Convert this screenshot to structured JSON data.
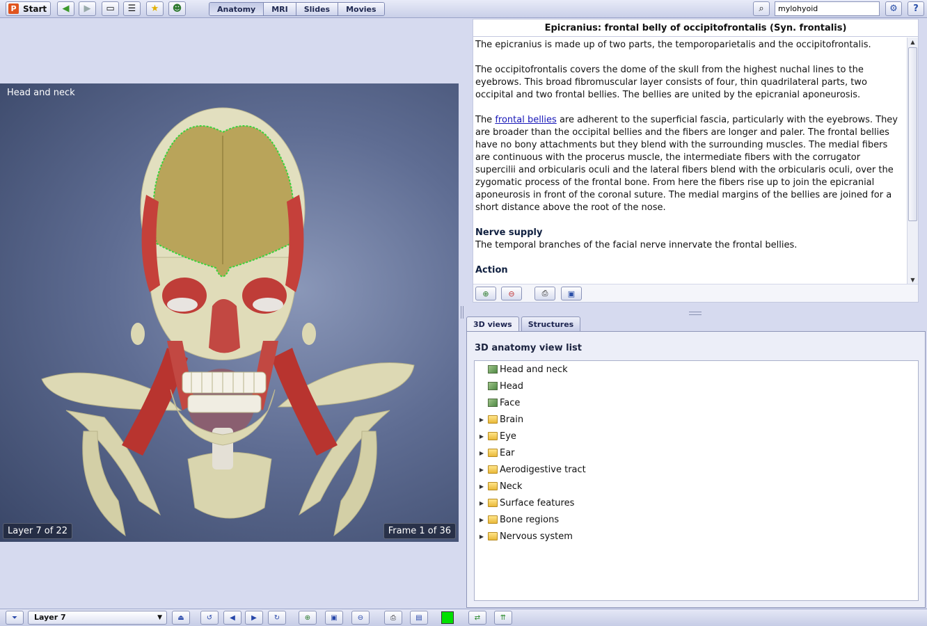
{
  "toolbar": {
    "start_label": "Start",
    "tabs": [
      "Anatomy",
      "MRI",
      "Slides",
      "Movies"
    ],
    "active_tab": "Anatomy",
    "search_value": "mylohyoid"
  },
  "viewer": {
    "title": "Head and neck",
    "layer_status": "Layer 7 of 22",
    "frame_status": "Frame 1 of 36"
  },
  "info": {
    "title": "Epicranius: frontal belly of occipitofrontalis (Syn. frontalis)",
    "para1": "The epicranius is made up of two parts, the temporoparietalis and the occipitofrontalis.",
    "para2": "The occipitofrontalis covers the dome of the skull from the highest nuchal lines to the eyebrows. This broad fibromuscular layer consists of four, thin quadrilateral parts, two occipital and two frontal bellies. The bellies are united by the epicranial aponeurosis.",
    "para3_pre": "The ",
    "para3_link": "frontal bellies",
    "para3_post": " are adherent to the superficial fascia, particularly with the eyebrows. They are broader than the occipital bellies and the fibers are longer and paler. The frontal bellies have no bony attachments but they blend with the surrounding muscles. The medial fibers are continuous with the procerus muscle, the intermediate fibers with the corrugator supercilii and orbicularis oculi and the lateral fibers blend with the orbicularis oculi, over the zygomatic process of the frontal bone. From here the fibers rise up to join the epicranial aponeurosis in front of the coronal suture. The medial margins of the bellies are joined for a short distance above the root of the nose.",
    "nerve_heading": "Nerve supply",
    "nerve_text": "The temporal branches of the facial nerve innervate the frontal bellies.",
    "action_heading": "Action"
  },
  "panel": {
    "tabs": [
      "3D views",
      "Structures"
    ],
    "active_tab": "3D views",
    "heading": "3D anatomy view list",
    "items": [
      {
        "label": "Head and neck",
        "type": "view"
      },
      {
        "label": "Head",
        "type": "view"
      },
      {
        "label": "Face",
        "type": "view"
      },
      {
        "label": "Brain",
        "type": "folder"
      },
      {
        "label": "Eye",
        "type": "folder"
      },
      {
        "label": "Ear",
        "type": "folder"
      },
      {
        "label": "Aerodigestive tract",
        "type": "folder"
      },
      {
        "label": "Neck",
        "type": "folder"
      },
      {
        "label": "Surface features",
        "type": "folder"
      },
      {
        "label": "Bone regions",
        "type": "folder"
      },
      {
        "label": "Nervous system",
        "type": "folder"
      }
    ]
  },
  "bottombar": {
    "layer_select": "Layer 7",
    "color": "#00e000"
  }
}
